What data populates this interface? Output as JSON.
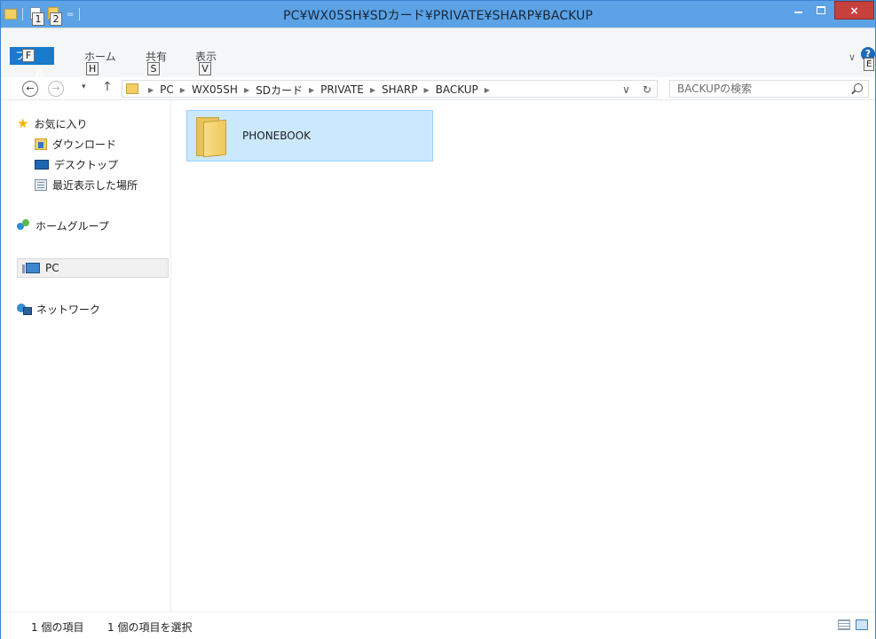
{
  "window": {
    "title": "PC¥WX05SH¥SDカード¥PRIVATE¥SHARP¥BACKUP",
    "close_glyph": "×"
  },
  "quick_access": {
    "keytip_1": "1",
    "keytip_2": "2",
    "dropdown_glyph": "="
  },
  "ribbon": {
    "file_tab": {
      "label": "ファイル",
      "label_left": "フ",
      "keytip": "F",
      "label_right": "ル"
    },
    "tabs": [
      {
        "label": "ホーム",
        "keytip": "H"
      },
      {
        "label": "共有",
        "keytip": "S"
      },
      {
        "label": "表示",
        "keytip": "V"
      }
    ],
    "expand_glyph": "∨",
    "help_glyph": "?",
    "help_keytip": "E"
  },
  "address": {
    "back_glyph": "←",
    "forward_glyph": "→",
    "recent_glyph": "▾",
    "up_glyph": "↑",
    "breadcrumbs": [
      "PC",
      "WX05SH",
      "SDカード",
      "PRIVATE",
      "SHARP",
      "BACKUP"
    ],
    "dropdown_glyph": "∨",
    "refresh_glyph": "↻"
  },
  "search": {
    "placeholder": "BACKUPの検索"
  },
  "navigation": {
    "favorites": "お気に入り",
    "downloads": "ダウンロード",
    "desktop": "デスクトップ",
    "recent_places": "最近表示した場所",
    "homegroup": "ホームグループ",
    "pc": "PC",
    "network": "ネットワーク"
  },
  "files": [
    {
      "name": "PHONEBOOK",
      "type": "folder",
      "selected": true
    }
  ],
  "status": {
    "item_count": "1 個の項目",
    "selected_count": "1 個の項目を選択"
  },
  "colors": {
    "title_bar": "#5ba2e6",
    "close_button": "#c7413c",
    "file_tab": "#1979ca",
    "selection": "#cce8ff"
  }
}
